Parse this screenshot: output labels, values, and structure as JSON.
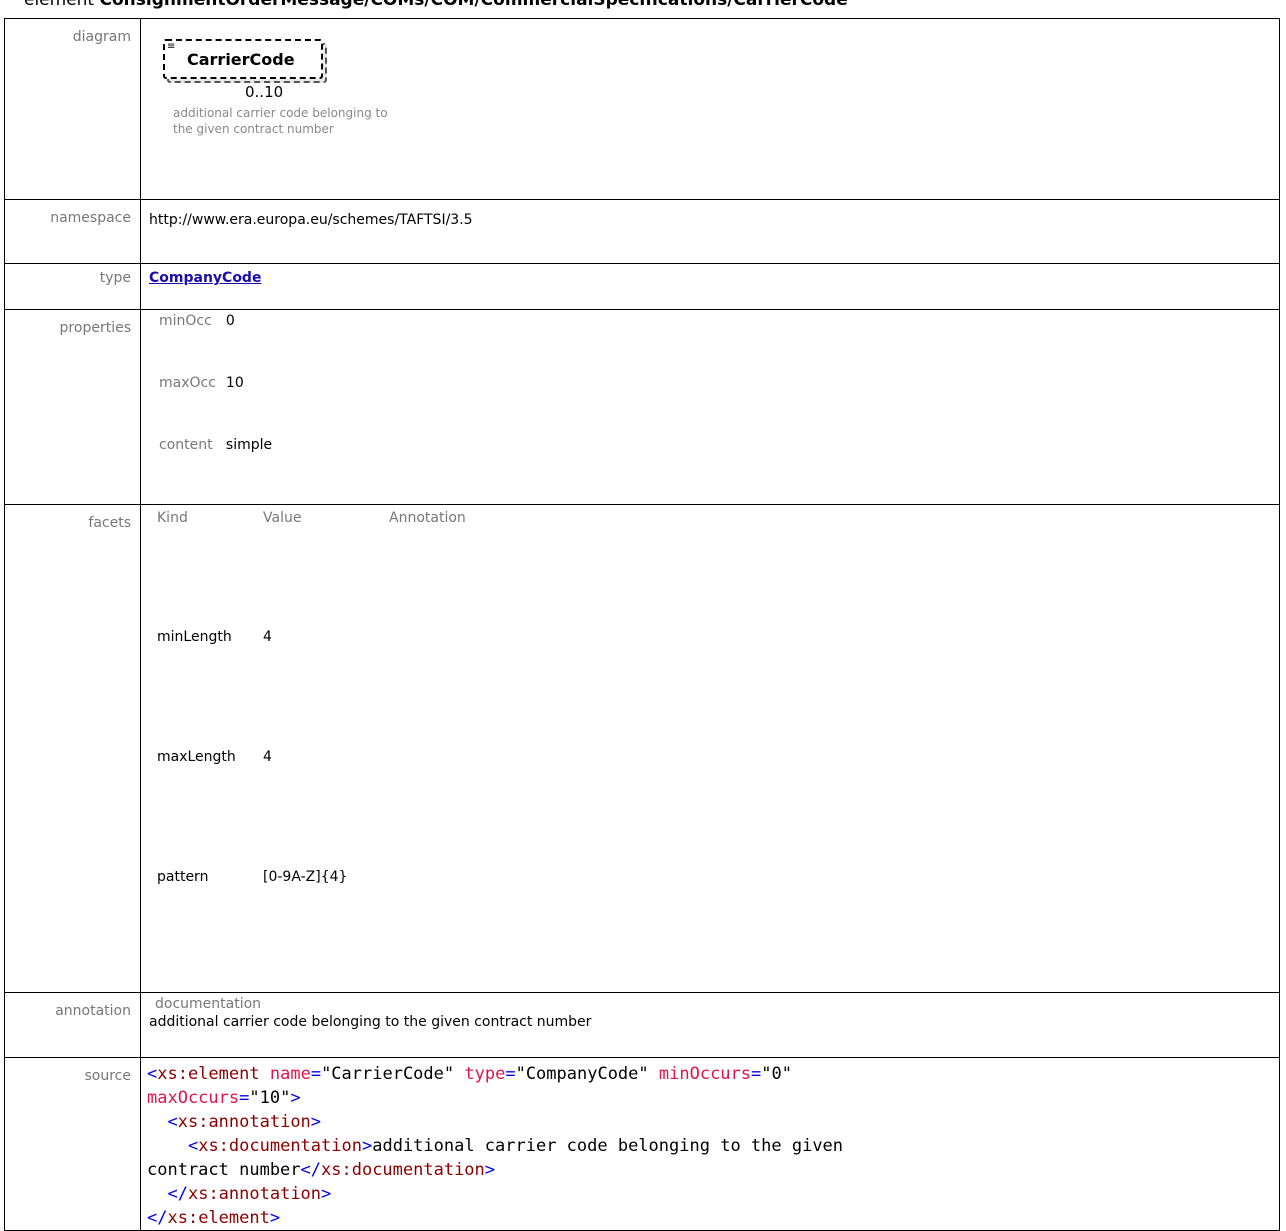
{
  "title": {
    "prefix": "element",
    "path": "ConsignmentOrderMessage/COMs/COM/CommercialSpecifications/CarrierCode"
  },
  "rows": {
    "diagram": {
      "label": "diagram",
      "element_name": "CarrierCode",
      "multiplicity": "0..10",
      "note": "additional carrier code belonging to the given contract number"
    },
    "namespace": {
      "label": "namespace",
      "value": "http://www.era.europa.eu/schemes/TAFTSI/3.5"
    },
    "type": {
      "label": "type",
      "value": "CompanyCode"
    },
    "properties": {
      "label": "properties",
      "items": [
        {
          "k": "minOcc",
          "v": "0"
        },
        {
          "k": "maxOcc",
          "v": "10"
        },
        {
          "k": "content",
          "v": "simple"
        }
      ]
    },
    "facets": {
      "label": "facets",
      "headers": [
        "Kind",
        "Value",
        "Annotation"
      ],
      "items": [
        {
          "kind": "minLength",
          "value": "4"
        },
        {
          "kind": "maxLength",
          "value": "4"
        },
        {
          "kind": "pattern",
          "value": "[0-9A-Z]{4}"
        }
      ]
    },
    "annotation": {
      "label": "annotation",
      "head": "documentation",
      "text": "additional carrier code belonging to the given contract number"
    },
    "source": {
      "label": "source",
      "line1_tag": "xs:element",
      "name_attr": "name",
      "name_val": "\"CarrierCode\"",
      "type_attr": "type",
      "type_val": "\"CompanyCode\"",
      "min_attr": "minOccurs",
      "min_val": "\"0\"",
      "max_attr": "maxOccurs",
      "max_val": "\"10\"",
      "annot_tag": "xs:annotation",
      "doc_tag": "xs:documentation",
      "doc_text_1": "additional carrier code belonging to the given",
      "doc_text_2": "contract number",
      "annot_close": "xs:annotation",
      "doc_close": "xs:documentation",
      "elem_close": "xs:element"
    }
  }
}
